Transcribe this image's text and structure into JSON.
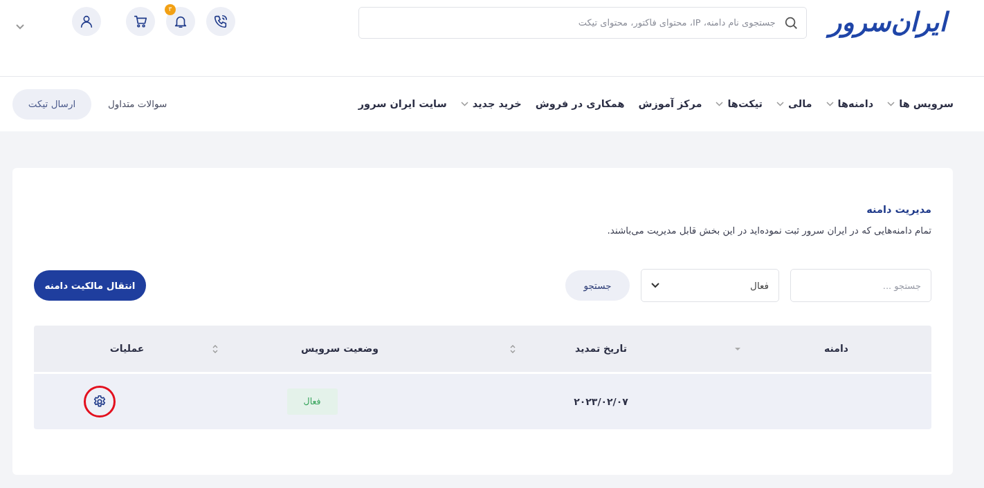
{
  "header": {
    "logo": "ایران‌سرور",
    "search": {
      "placeholder": "جستجوی نام دامنه، IP، محتوای فاکتور، محتوای تیکت"
    },
    "actions": [
      {
        "kind": "phone"
      },
      {
        "kind": "bell",
        "badge": "۳"
      },
      {
        "kind": "cart"
      },
      {
        "kind": "user"
      }
    ]
  },
  "nav": {
    "items": [
      {
        "label": "سرویس ها",
        "dropdown": true
      },
      {
        "label": "دامنه‌ها",
        "dropdown": true
      },
      {
        "label": "مالی",
        "dropdown": true
      },
      {
        "label": "تیکت‌ها",
        "dropdown": true
      },
      {
        "label": "مرکز آموزش",
        "dropdown": false
      },
      {
        "label": "همکاری در فروش",
        "dropdown": false
      },
      {
        "label": "خرید جدید",
        "dropdown": true
      },
      {
        "label": "سایت ایران سرور",
        "dropdown": false
      }
    ],
    "faq": "سوالات متداول",
    "ticket_button": "ارسال تیکت"
  },
  "page": {
    "title": "مدیریت دامنه",
    "description": "تمام دامنه‌هایی که در ایران سرور ثبت نموده‌اید در این بخش قابل مدیریت می‌باشند.",
    "filter": {
      "search_placeholder": "جستجو ...",
      "status_value": "فعال",
      "search_button": "جستجو"
    },
    "transfer_button": "انتقال مالکیت دامنه"
  },
  "table": {
    "columns": [
      {
        "label": "دامنه",
        "sortable": true,
        "sorted": true
      },
      {
        "label": "تاریخ تمدید",
        "sortable": true,
        "sorted": false
      },
      {
        "label": "وضعیت سرویس",
        "sortable": true,
        "sorted": false
      },
      {
        "label": "عملیات",
        "sortable": false
      }
    ],
    "rows": [
      {
        "date": "۲۰۲۳/۰۲/۰۷",
        "status": "فعال",
        "active": true,
        "highlighted": true
      }
    ]
  }
}
